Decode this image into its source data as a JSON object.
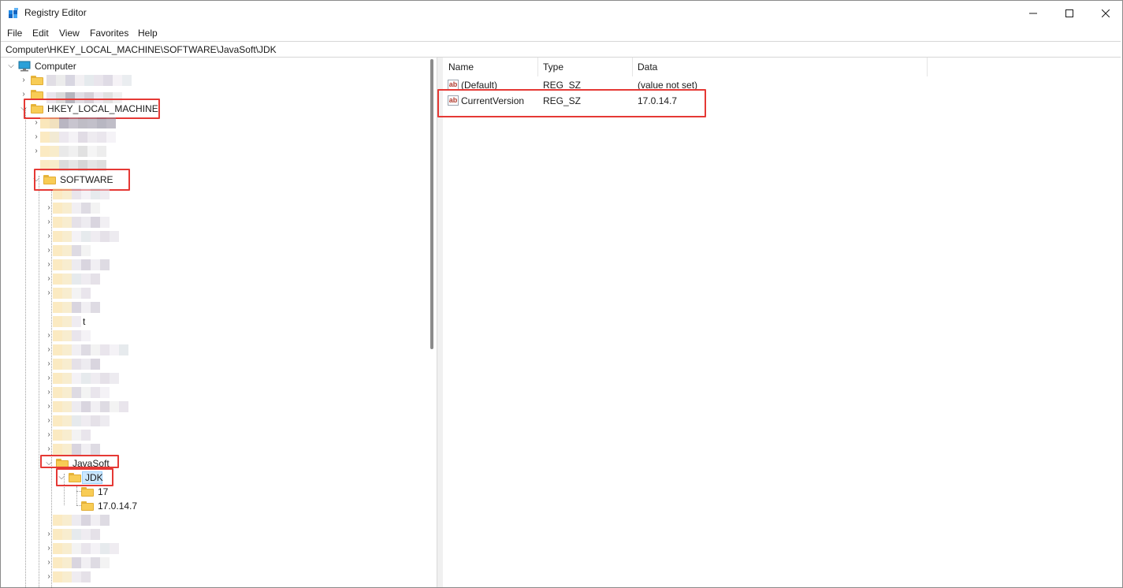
{
  "window": {
    "title": "Registry Editor"
  },
  "menu": {
    "file": "File",
    "edit": "Edit",
    "view": "View",
    "favorites": "Favorites",
    "help": "Help"
  },
  "address": {
    "path": "Computer\\HKEY_LOCAL_MACHINE\\SOFTWARE\\JavaSoft\\JDK"
  },
  "tree": {
    "root": "Computer",
    "hklm": "HKEY_LOCAL_MACHINE",
    "software": "SOFTWARE",
    "javasoft": "JavaSoft",
    "jdk": "JDK",
    "jdk_children": [
      "17",
      "17.0.14.7"
    ],
    "partial_glyph": "t"
  },
  "list": {
    "columns": [
      "Name",
      "Type",
      "Data"
    ],
    "rows": [
      {
        "name": "(Default)",
        "type": "REG_SZ",
        "data": "(value not set)"
      },
      {
        "name": "CurrentVersion",
        "type": "REG_SZ",
        "data": "17.0.14.7"
      }
    ]
  },
  "colors": {
    "highlight_box": "#e53935",
    "selection": "#cce8ff",
    "folder": "#f8cc55"
  },
  "icons": {
    "app": "registry-editor-icon",
    "computer": "computer-icon",
    "folder": "folder-icon",
    "string_value": "string-value-icon"
  }
}
